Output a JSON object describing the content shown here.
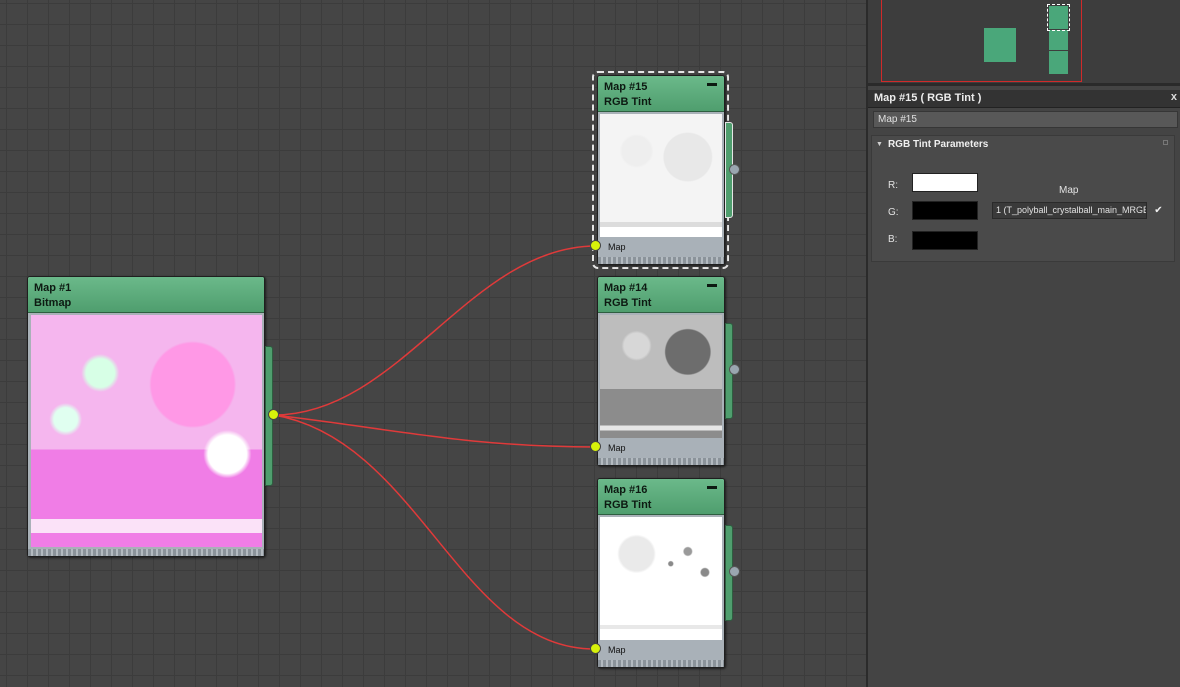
{
  "nodes": [
    {
      "id": "map1",
      "title": "Map #1",
      "type": "Bitmap"
    },
    {
      "id": "map15",
      "title": "Map #15",
      "type": "RGB Tint",
      "slot_label": "Map",
      "selected": true
    },
    {
      "id": "map14",
      "title": "Map #14",
      "type": "RGB Tint",
      "slot_label": "Map"
    },
    {
      "id": "map16",
      "title": "Map #16",
      "type": "RGB Tint",
      "slot_label": "Map"
    }
  ],
  "colors": {
    "node_header": "#5aaa7a",
    "wire": "#e03a3a",
    "port_in": "#d7f20a",
    "canvas_bg": "#454545"
  },
  "parameter_editor": {
    "title": "Map #15  ( RGB Tint )",
    "close_label": "x",
    "name_value": "Map #15",
    "rollout_title": "RGB Tint Parameters",
    "channels": [
      {
        "label": "R:",
        "color": "#ffffff"
      },
      {
        "label": "G:",
        "color": "#000000"
      },
      {
        "label": "B:",
        "color": "#000000"
      }
    ],
    "map_heading": "Map",
    "map_slot_text": "1 (T_polyball_crystalball_main_MRGB",
    "map_enabled_check": "✔"
  }
}
